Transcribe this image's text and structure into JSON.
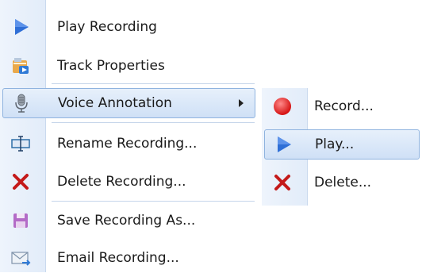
{
  "context_menu": {
    "items": [
      {
        "label": "Play Recording",
        "icon": "play-icon"
      },
      {
        "label": "Track Properties",
        "icon": "track-properties-icon"
      },
      {
        "label": "Voice Annotation",
        "icon": "microphone-icon",
        "has_submenu": true
      },
      {
        "label": "Rename Recording...",
        "icon": "rename-icon"
      },
      {
        "label": "Delete Recording...",
        "icon": "delete-icon"
      },
      {
        "label": "Save Recording As...",
        "icon": "save-icon"
      },
      {
        "label": "Email Recording...",
        "icon": "email-icon"
      }
    ]
  },
  "submenu": {
    "items": [
      {
        "label": "Record...",
        "icon": "record-icon"
      },
      {
        "label": "Play...",
        "icon": "play-icon"
      },
      {
        "label": "Delete...",
        "icon": "delete-icon"
      }
    ]
  },
  "colors": {
    "highlight": "#cfe0f6",
    "highlight_border": "#8fb3df",
    "play_blue": "#2f6fd6",
    "record_red": "#e02020",
    "delete_red": "#c41a1a"
  }
}
